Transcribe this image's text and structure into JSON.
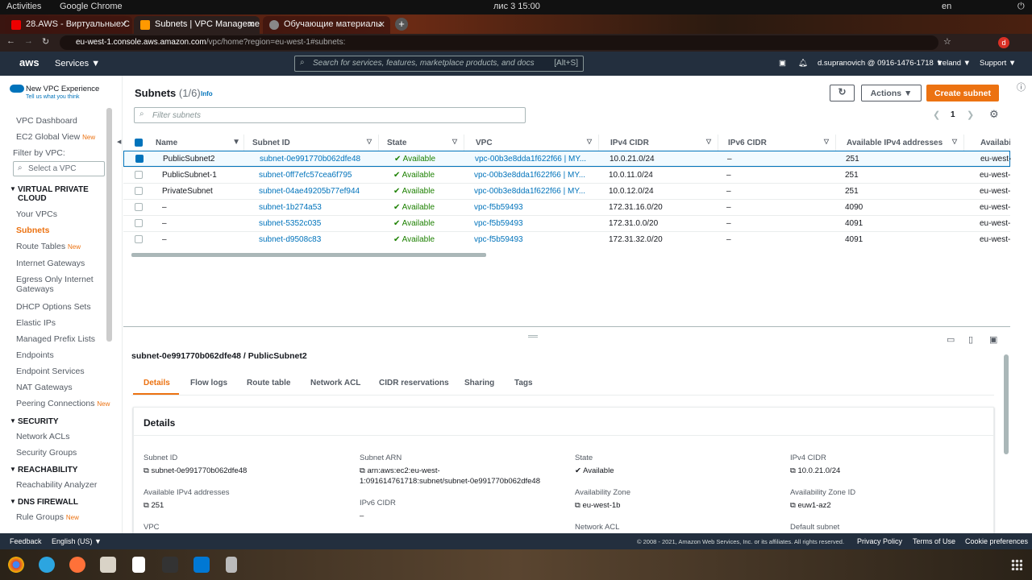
{
  "gnome": {
    "activities": "Activities",
    "app": "Google Chrome",
    "clock": "лис 3  15:00",
    "lang": "en"
  },
  "tabs": [
    {
      "label": "28.AWS - Виртуальные С"
    },
    {
      "label": "Subnets | VPC Manageme"
    },
    {
      "label": "Обучающие материалы"
    }
  ],
  "address": {
    "host": "eu-west-1.console.aws.amazon.com",
    "path": "/vpc/home?region=eu-west-1#subnets:"
  },
  "aws": {
    "logo": "aws",
    "services": "Services ▼",
    "search_placeholder": "Search for services, features, marketplace products, and docs",
    "search_kbd": "[Alt+S]",
    "user": "d.supranovich @ 0916-1476-1718 ▼",
    "region": "Ireland ▼",
    "support": "Support ▼"
  },
  "sidebar": {
    "new_vpc": "New VPC Experience",
    "tell_us": "Tell us what you think",
    "dashboard": "VPC Dashboard",
    "ec2_global": "EC2 Global View",
    "new": "New",
    "filter_label": "Filter by VPC:",
    "filter_placeholder": "Select a VPC",
    "sec_vpc": "VIRTUAL PRIVATE CLOUD",
    "items_vpc": [
      "Your VPCs",
      "Subnets",
      "Route Tables",
      "Internet Gateways",
      "Egress Only Internet Gateways",
      "DHCP Options Sets",
      "Elastic IPs",
      "Managed Prefix Lists",
      "Endpoints",
      "Endpoint Services",
      "NAT Gateways",
      "Peering Connections"
    ],
    "sec_security": "SECURITY",
    "items_security": [
      "Network ACLs",
      "Security Groups"
    ],
    "sec_reach": "REACHABILITY",
    "items_reach": [
      "Reachability Analyzer"
    ],
    "sec_dns": "DNS FIREWALL",
    "items_dns": [
      "Rule Groups"
    ]
  },
  "main": {
    "title": "Subnets",
    "count": "(1/6)",
    "info": "Info",
    "actions": "Actions ▼",
    "create": "Create subnet",
    "filter_placeholder": "Filter subnets",
    "page": "1"
  },
  "columns": [
    "Name",
    "Subnet ID",
    "State",
    "VPC",
    "IPv4 CIDR",
    "IPv6 CIDR",
    "Available IPv4 addresses",
    "Availabi"
  ],
  "rows": [
    {
      "name": "PublicSubnet2",
      "id": "subnet-0e991770b062dfe48",
      "state": "Available",
      "vpc": "vpc-00b3e8dda1f622f66 | MY...",
      "cidr": "10.0.21.0/24",
      "ipv6": "–",
      "avail": "251",
      "az": "eu-west-"
    },
    {
      "name": "PublicSubnet-1",
      "id": "subnet-0ff7efc57cea6f795",
      "state": "Available",
      "vpc": "vpc-00b3e8dda1f622f66 | MY...",
      "cidr": "10.0.11.0/24",
      "ipv6": "–",
      "avail": "251",
      "az": "eu-west-"
    },
    {
      "name": "PrivateSubnet",
      "id": "subnet-04ae49205b77ef944",
      "state": "Available",
      "vpc": "vpc-00b3e8dda1f622f66 | MY...",
      "cidr": "10.0.12.0/24",
      "ipv6": "–",
      "avail": "251",
      "az": "eu-west-"
    },
    {
      "name": "–",
      "id": "subnet-1b274a53",
      "state": "Available",
      "vpc": "vpc-f5b59493",
      "cidr": "172.31.16.0/20",
      "ipv6": "–",
      "avail": "4090",
      "az": "eu-west-"
    },
    {
      "name": "–",
      "id": "subnet-5352c035",
      "state": "Available",
      "vpc": "vpc-f5b59493",
      "cidr": "172.31.0.0/20",
      "ipv6": "–",
      "avail": "4091",
      "az": "eu-west-"
    },
    {
      "name": "–",
      "id": "subnet-d9508c83",
      "state": "Available",
      "vpc": "vpc-f5b59493",
      "cidr": "172.31.32.0/20",
      "ipv6": "–",
      "avail": "4091",
      "az": "eu-west-"
    }
  ],
  "detail": {
    "heading": "subnet-0e991770b062dfe48 / PublicSubnet2",
    "tabs": [
      "Details",
      "Flow logs",
      "Route table",
      "Network ACL",
      "CIDR reservations",
      "Sharing",
      "Tags"
    ],
    "card_title": "Details",
    "subnet_id_label": "Subnet ID",
    "subnet_id": "subnet-0e991770b062dfe48",
    "arn_label": "Subnet ARN",
    "arn_1": "arn:aws:ec2:eu-west-",
    "arn_2": "1:091614761718:subnet/subnet-0e991770b062dfe48",
    "state_label": "State",
    "state": "Available",
    "ipv4_label": "IPv4 CIDR",
    "ipv4": "10.0.21.0/24",
    "avail_label": "Available IPv4 addresses",
    "avail": "251",
    "ipv6_label": "IPv6 CIDR",
    "ipv6": "–",
    "az_label": "Availability Zone",
    "az": "eu-west-1b",
    "azid_label": "Availability Zone ID",
    "azid": "euw1-az2",
    "vpc_label": "VPC",
    "nacl_label": "Network ACL",
    "default_label": "Default subnet"
  },
  "footer": {
    "feedback": "Feedback",
    "lang": "English (US) ▼",
    "copy": "© 2008 - 2021, Amazon Web Services, Inc. or its affiliates. All rights reserved.",
    "privacy": "Privacy Policy",
    "terms": "Terms of Use",
    "cookies": "Cookie preferences"
  }
}
